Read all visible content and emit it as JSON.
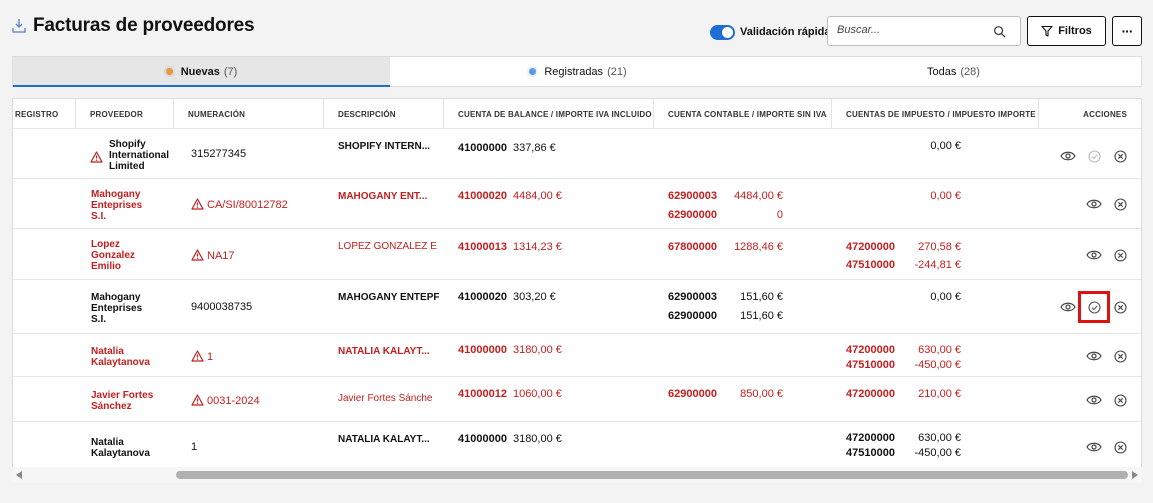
{
  "header": {
    "title": "Facturas de proveedores",
    "toggle_label": "Validación rápida",
    "toggle_on": true,
    "search_placeholder": "Buscar...",
    "filter_label": "Filtros",
    "more_label": "···"
  },
  "tabs": [
    {
      "label": "Nuevas",
      "count": "(7)",
      "dot_color": "#e89a3c",
      "active": true
    },
    {
      "label": "Registradas",
      "count": "(21)",
      "dot_color": "#5b9be8",
      "active": false
    },
    {
      "label": "Todas",
      "count": "(28)",
      "active": false
    }
  ],
  "columns": {
    "registro": "REGISTRO",
    "proveedor": "PROVEEDOR",
    "numeracion": "NUMERACIÓN",
    "descripcion": "DESCRIPCIÓN",
    "cuenta_balance": "CUENTA DE BALANCE / IMPORTE IVA INCLUIDO",
    "cuenta_contable": "CUENTA CONTABLE / IMPORTE SIN IVA",
    "cuentas_impuesto": "CUENTAS DE IMPUESTO / IMPUESTO IMPORTE",
    "acciones": "ACCIONES"
  },
  "rows": [
    {
      "proveedor": [
        "Shopify",
        "International",
        "Limited"
      ],
      "numeracion": "315277345",
      "descripcion": "SHOPIFY INTERN...",
      "balance_cuenta": "41000000",
      "balance_importe": "337,86 €",
      "contable_1_cuenta": "",
      "contable_1_importe": "",
      "contable_2_cuenta": "",
      "contable_2_importe": "",
      "impuesto_1_cuenta": "",
      "impuesto_1_importe": "0,00 €",
      "impuesto_2_cuenta": "",
      "impuesto_2_importe": ""
    },
    {
      "proveedor": [
        "Mahogany",
        "Enteprises",
        "S.I."
      ],
      "numeracion": "CA/SI/80012782",
      "descripcion": "MAHOGANY ENT...",
      "balance_cuenta": "41000020",
      "balance_importe": "4484,00 €",
      "contable_1_cuenta": "62900003",
      "contable_1_importe": "4484,00 €",
      "contable_2_cuenta": "62900000",
      "contable_2_importe": "0",
      "impuesto_1_cuenta": "",
      "impuesto_1_importe": "0,00 €",
      "impuesto_2_cuenta": "",
      "impuesto_2_importe": ""
    },
    {
      "proveedor": [
        "Lopez",
        "Gonzalez",
        "Emilio"
      ],
      "numeracion": "NA17",
      "descripcion": "LOPEZ GONZALEZ E",
      "balance_cuenta": "41000013",
      "balance_importe": "1314,23 €",
      "contable_1_cuenta": "67800000",
      "contable_1_importe": "1288,46 €",
      "contable_2_cuenta": "",
      "contable_2_importe": "",
      "impuesto_1_cuenta": "47200000",
      "impuesto_1_importe": "270,58 €",
      "impuesto_2_cuenta": "47510000",
      "impuesto_2_importe": "-244,81 €"
    },
    {
      "proveedor": [
        "Mahogany",
        "Enteprises",
        "S.I."
      ],
      "numeracion": "9400038735",
      "descripcion": "MAHOGANY ENTEPF",
      "balance_cuenta": "41000020",
      "balance_importe": "303,20 €",
      "contable_1_cuenta": "62900003",
      "contable_1_importe": "151,60 €",
      "contable_2_cuenta": "62900000",
      "contable_2_importe": "151,60 €",
      "impuesto_1_cuenta": "",
      "impuesto_1_importe": "0,00 €",
      "impuesto_2_cuenta": "",
      "impuesto_2_importe": ""
    },
    {
      "proveedor": [
        "Natalia",
        "Kalaytanova"
      ],
      "numeracion": "1",
      "descripcion": "NATALIA KALAYT...",
      "balance_cuenta": "41000000",
      "balance_importe": "3180,00 €",
      "contable_1_cuenta": "",
      "contable_1_importe": "",
      "contable_2_cuenta": "",
      "contable_2_importe": "",
      "impuesto_1_cuenta": "47200000",
      "impuesto_1_importe": "630,00 €",
      "impuesto_2_cuenta": "47510000",
      "impuesto_2_importe": "-450,00 €"
    },
    {
      "proveedor": [
        "Javier Fortes",
        "Sánchez"
      ],
      "numeracion": "0031-2024",
      "descripcion": "Javier Fortes Sánche",
      "balance_cuenta": "41000012",
      "balance_importe": "1060,00 €",
      "contable_1_cuenta": "62900000",
      "contable_1_importe": "850,00 €",
      "contable_2_cuenta": "",
      "contable_2_importe": "",
      "impuesto_1_cuenta": "47200000",
      "impuesto_1_importe": "210,00 €",
      "impuesto_2_cuenta": "",
      "impuesto_2_importe": ""
    },
    {
      "proveedor": [
        "Natalia",
        "Kalaytanova"
      ],
      "numeracion": "1",
      "descripcion": "NATALIA KALAYT...",
      "balance_cuenta": "41000000",
      "balance_importe": "3180,00 €",
      "contable_1_cuenta": "",
      "contable_1_importe": "",
      "contable_2_cuenta": "",
      "contable_2_importe": "",
      "impuesto_1_cuenta": "47200000",
      "impuesto_1_importe": "630,00 €",
      "impuesto_2_cuenta": "47510000",
      "impuesto_2_importe": "-450,00 €"
    }
  ],
  "colors": {
    "accent": "#1f6ed4",
    "error_red": "#c41e1e",
    "highlight_red": "#dd1111"
  },
  "icons": [
    "download-icon",
    "search-icon",
    "filter-icon",
    "warning-icon",
    "eye-icon",
    "check-circle-icon",
    "close-circle-icon",
    "scroll-left-icon",
    "scroll-right-icon"
  ]
}
